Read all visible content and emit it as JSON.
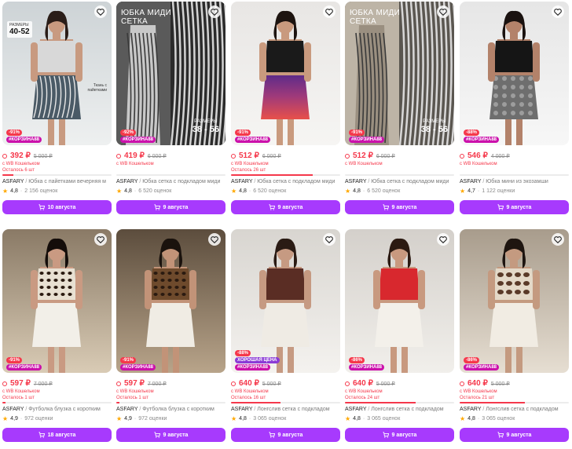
{
  "colors": {
    "accent": "#a73afd",
    "price": "#f5384b",
    "tag": "#cb11ab",
    "good_price": "#8b3bd6",
    "star": "#ffa800"
  },
  "icons": {
    "favorite": "heart-icon",
    "cart": "cart-icon",
    "rating": "star-icon",
    "wb_wallet": "wallet-circle-icon"
  },
  "products": [
    {
      "overlay": {
        "sizes_label": "РАЗМЕРЫ",
        "sizes_range": "40-52",
        "fabric_note": "Ткань с пайетками"
      },
      "badges": [
        "-91%",
        "#КОРЗИНА88"
      ],
      "price": "392 ₽",
      "old_price": "5 000 ₽",
      "wallet": "с WB Кошельком",
      "stock": "Осталось 6 шт",
      "stock_level": 0.1,
      "brand": "ASFARY",
      "separator": "/",
      "name": "Юбка с пайетками вечерняя м",
      "rating": "4,8",
      "dot": "·",
      "reviews": "2 156 оценок",
      "delivery": "10 августа"
    },
    {
      "overlay": {
        "title_line1": "ЮБКА МИДИ",
        "title_line2": "СЕТКА",
        "range_label": "РАЗМЕРЫ",
        "range": "38 - 56"
      },
      "badges": [
        "-92%",
        "#КОРЗИНА88"
      ],
      "price": "419 ₽",
      "old_price": "6 000 ₽",
      "wallet": "с WB Кошельком",
      "stock": "",
      "stock_level": 0,
      "brand": "ASFARY",
      "separator": "/",
      "name": "Юбка сетка с подкладом миди",
      "rating": "4,8",
      "dot": "·",
      "reviews": "6 520 оценок",
      "delivery": "9 августа"
    },
    {
      "overlay": {},
      "badges": [
        "-91%",
        "#КОРЗИНА88"
      ],
      "price": "512 ₽",
      "old_price": "6 000 ₽",
      "wallet": "с WB Кошельком",
      "stock": "Осталось 26 шт",
      "stock_level": 0.75,
      "brand": "ASFARY",
      "separator": "/",
      "name": "Юбка сетка с подкладом миди",
      "rating": "4,8",
      "dot": "·",
      "reviews": "6 520 оценок",
      "delivery": "9 августа"
    },
    {
      "overlay": {
        "title_line1": "ЮБКА МИДИ",
        "title_line2": "СЕТКА",
        "range_label": "РАЗМЕРЫ",
        "range": "38 - 56"
      },
      "badges": [
        "-91%",
        "#КОРЗИНА88"
      ],
      "price": "512 ₽",
      "old_price": "6 000 ₽",
      "wallet": "с WB Кошельком",
      "stock": "",
      "stock_level": 0,
      "brand": "ASFARY",
      "separator": "/",
      "name": "Юбка сетка с подкладом миди",
      "rating": "4,8",
      "dot": "·",
      "reviews": "6 520 оценок",
      "delivery": "9 августа"
    },
    {
      "overlay": {},
      "badges": [
        "-88%",
        "#КОРЗИНА88"
      ],
      "price": "546 ₽",
      "old_price": "4 000 ₽",
      "wallet": "с WB Кошельком",
      "stock": "",
      "stock_level": 0,
      "brand": "ASFARY",
      "separator": "/",
      "name": "Юбка мини из экозамши",
      "rating": "4,7",
      "dot": "·",
      "reviews": "1 122 оценки",
      "delivery": "9 августа"
    },
    {
      "overlay": {},
      "badges": [
        "-91%",
        "#КОРЗИНА88"
      ],
      "price": "597 ₽",
      "old_price": "7 000 ₽",
      "wallet": "с WB Кошельком",
      "stock": "Осталось 1 шт",
      "stock_level": 0.03,
      "brand": "ASFARY",
      "separator": "/",
      "name": "Футболка блузка с коротким",
      "rating": "4,9",
      "dot": "·",
      "reviews": "972 оценки",
      "delivery": "18 августа"
    },
    {
      "overlay": {},
      "badges": [
        "-91%",
        "#КОРЗИНА88"
      ],
      "price": "597 ₽",
      "old_price": "7 000 ₽",
      "wallet": "с WB Кошельком",
      "stock": "Осталось 1 шт",
      "stock_level": 0.03,
      "brand": "ASFARY",
      "separator": "/",
      "name": "Футболка блузка с коротким",
      "rating": "4,9",
      "dot": "·",
      "reviews": "972 оценки",
      "delivery": "9 августа"
    },
    {
      "overlay": {},
      "badges": [
        "-88%",
        "ХОРОШАЯ ЦЕНА",
        "#КОРЗИНА88"
      ],
      "price": "640 ₽",
      "old_price": "5 000 ₽",
      "wallet": "с WB Кошельком",
      "stock": "Осталось 16 шт",
      "stock_level": 0.45,
      "brand": "ASFARY",
      "separator": "/",
      "name": "Лонгслив сетка с подкладом",
      "rating": "4,8",
      "dot": "·",
      "reviews": "3 065 оценок",
      "delivery": "9 августа"
    },
    {
      "overlay": {},
      "badges": [
        "-86%",
        "#КОРЗИНА88"
      ],
      "price": "640 ₽",
      "old_price": "5 000 ₽",
      "wallet": "с WB Кошельком",
      "stock": "Осталось 24 шт",
      "stock_level": 0.65,
      "brand": "ASFARY",
      "separator": "/",
      "name": "Лонгслив сетка с подкладом",
      "rating": "4,8",
      "dot": "·",
      "reviews": "3 065 оценок",
      "delivery": "9 августа"
    },
    {
      "overlay": {},
      "badges": [
        "-86%",
        "#КОРЗИНА88"
      ],
      "price": "640 ₽",
      "old_price": "5 000 ₽",
      "wallet": "с WB Кошельком",
      "stock": "Осталось 21 шт",
      "stock_level": 0.6,
      "brand": "ASFARY",
      "separator": "/",
      "name": "Лонгслив сетка с подкладом",
      "rating": "4,8",
      "dot": "·",
      "reviews": "3 065 оценок",
      "delivery": "9 августа"
    }
  ]
}
